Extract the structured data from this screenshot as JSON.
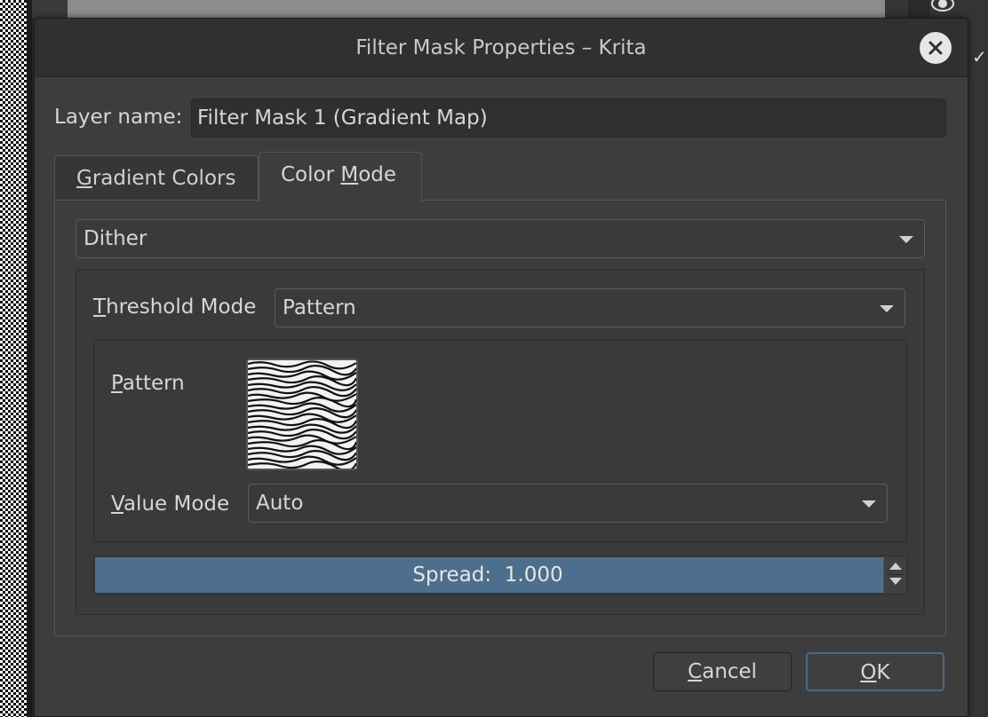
{
  "window": {
    "title": "Filter Mask Properties – Krita"
  },
  "layer_name": {
    "label_mnemonic": "",
    "label": "Layer name:",
    "value": "Filter Mask 1 (Gradient Map)"
  },
  "tabs": [
    {
      "mnemonic": "G",
      "rest": "radient Colors",
      "active": false
    },
    {
      "before": "Color ",
      "mnemonic": "M",
      "rest": "ode",
      "active": true
    }
  ],
  "color_mode": {
    "value": "Dither"
  },
  "threshold": {
    "label_mnemonic": "T",
    "label_rest": "hreshold Mode",
    "value": "Pattern"
  },
  "pattern": {
    "label_mnemonic": "P",
    "label_rest": "attern"
  },
  "value_mode": {
    "label_mnemonic": "V",
    "label_rest": "alue Mode",
    "value": "Auto"
  },
  "spread": {
    "text": "Spread:  1.000",
    "fill_fraction": 1.0
  },
  "buttons": {
    "cancel_mnemonic": "C",
    "cancel_rest": "ancel",
    "ok_mnemonic": "O",
    "ok_rest": "K"
  },
  "colors": {
    "accent": "#4d6e8c",
    "dialog_bg": "#3d3d3d"
  }
}
